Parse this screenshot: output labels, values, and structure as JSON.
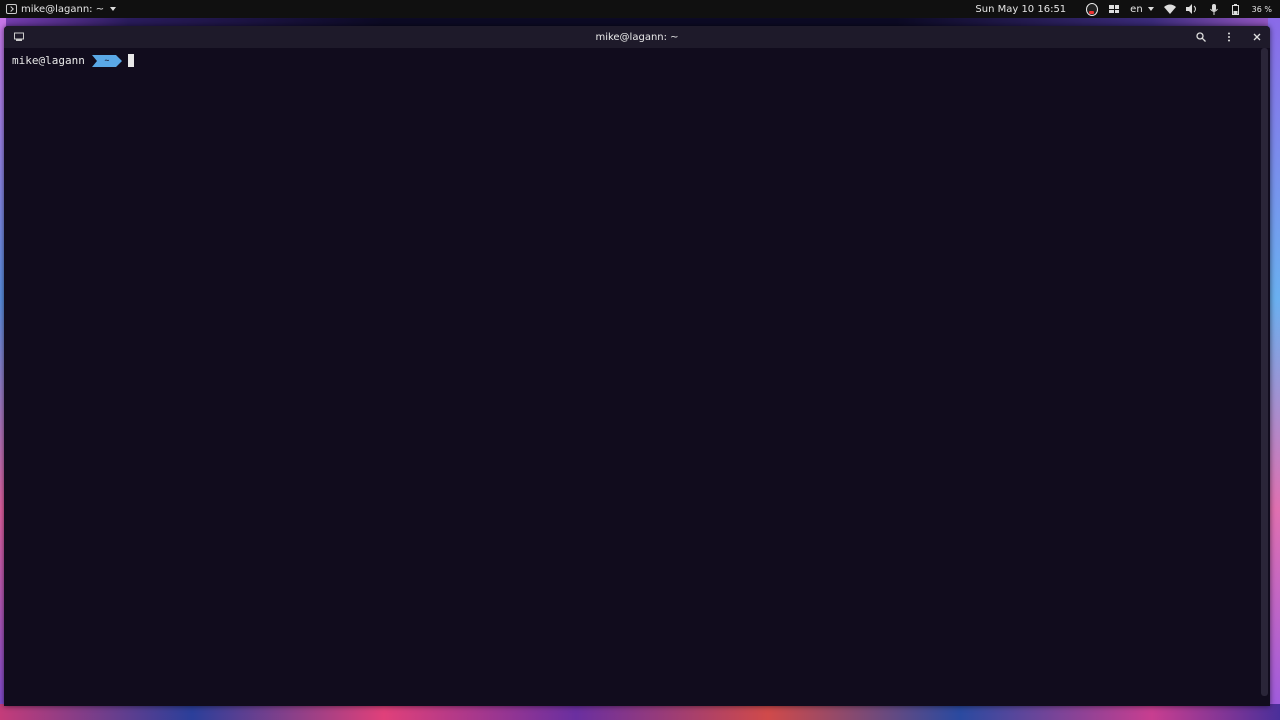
{
  "top_panel": {
    "app_title": "mike@lagann: ~",
    "clock": "Sun May 10  16:51",
    "language": "en",
    "battery": "36 %"
  },
  "window": {
    "title": "mike@lagann: ~",
    "icons": {
      "left": "terminal-tab-icon",
      "search": "search-icon",
      "menu": "kebab-menu-icon",
      "close": "close-icon"
    }
  },
  "terminal": {
    "prompt_user": "mike@lagann",
    "prompt_dir": "~",
    "segment_color": "#5aa8e6"
  },
  "colors": {
    "terminal_bg": "#110c1d",
    "titlebar_bg": "#1e1a2a",
    "panel_bg": "#101010"
  }
}
